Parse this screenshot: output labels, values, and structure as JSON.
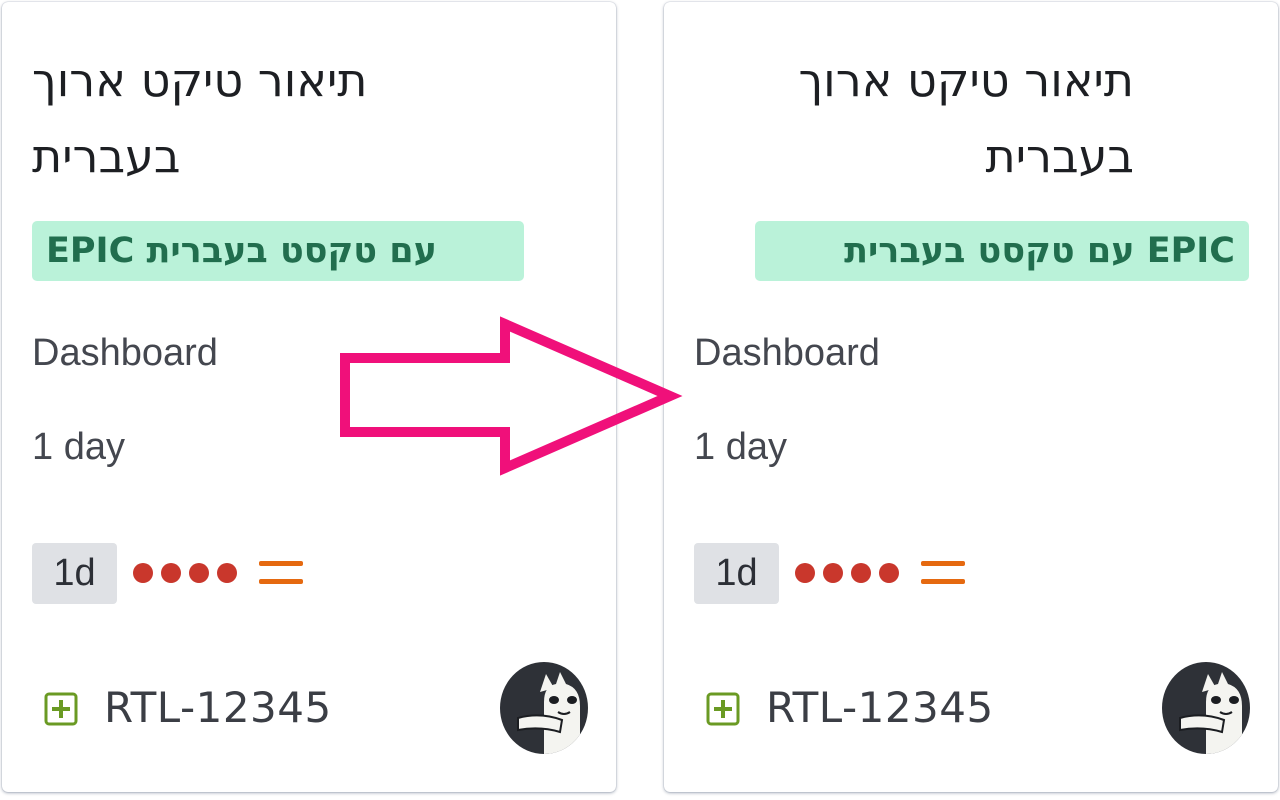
{
  "cards": [
    {
      "title": "תיאור טיקט ארוך בעברית",
      "epic": "EPIC עם טקסט בעברית",
      "component": "Dashboard",
      "duration": "1 day",
      "estimate": "1d",
      "priority_icon": "priority-medium-icon",
      "issue_type_icon": "story-icon",
      "issue_key": "RTL-12345",
      "avatar_icon": "cat-avatar-icon"
    },
    {
      "title": "תיאור טיקט ארוך בעברית",
      "epic": "EPIC עם טקסט בעברית",
      "component": "Dashboard",
      "duration": "1 day",
      "estimate": "1d",
      "priority_icon": "priority-medium-icon",
      "issue_type_icon": "story-icon",
      "issue_key": "RTL-12345",
      "avatar_icon": "cat-avatar-icon"
    }
  ],
  "colors": {
    "epic_bg": "#baf2d9",
    "epic_text": "#216e4e",
    "dot_red": "#c9372c",
    "priority_orange": "#e56910",
    "story_green": "#6a9a23",
    "arrow_pink": "#f0107a"
  },
  "annotation_icon": "right-arrow-icon"
}
